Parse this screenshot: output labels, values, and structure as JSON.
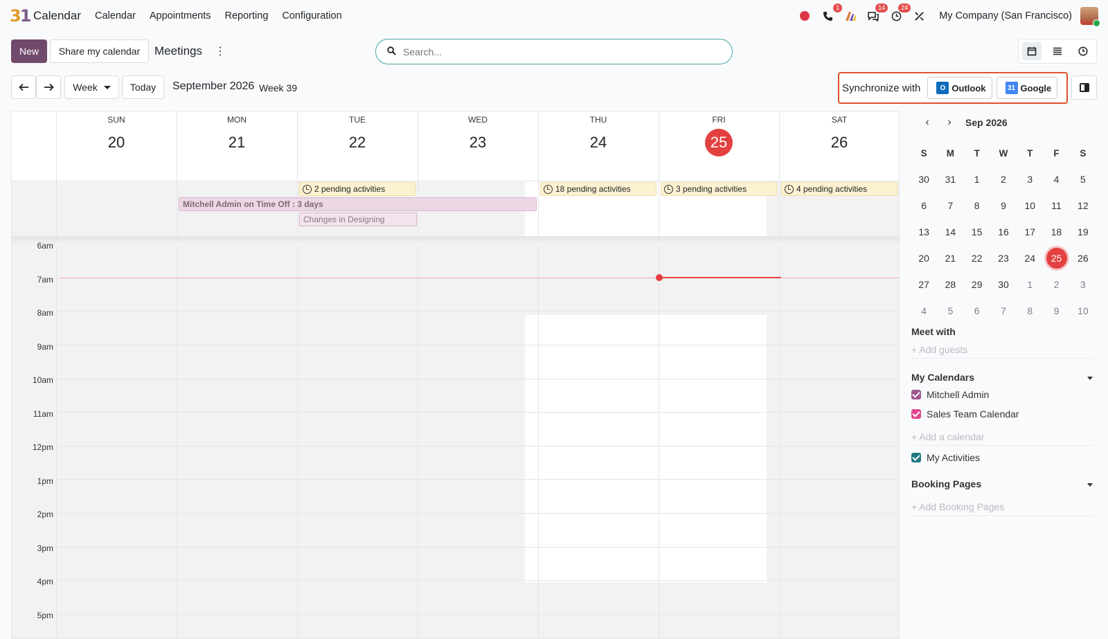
{
  "app": {
    "name": "Calendar"
  },
  "menu": [
    "Calendar",
    "Appointments",
    "Reporting",
    "Configuration"
  ],
  "systray": {
    "phone_badge": "1",
    "chat_badge": "14",
    "activity_badge": "24",
    "company": "My Company (San Francisco)"
  },
  "toolbar": {
    "new_label": "New",
    "share_label": "Share my calendar",
    "title": "Meetings",
    "search_placeholder": "Search...",
    "scale_label": "Week",
    "today_label": "Today",
    "date_label": "September 2026",
    "week_label": "Week 39",
    "sync_label": "Synchronize with",
    "outlook_label": "Outlook",
    "google_label": "Google"
  },
  "week": {
    "days": [
      {
        "name": "SUN",
        "num": "20"
      },
      {
        "name": "MON",
        "num": "21"
      },
      {
        "name": "TUE",
        "num": "22"
      },
      {
        "name": "WED",
        "num": "23"
      },
      {
        "name": "THU",
        "num": "24"
      },
      {
        "name": "FRI",
        "num": "25",
        "today": true
      },
      {
        "name": "SAT",
        "num": "26"
      }
    ],
    "hours": [
      "6am",
      "7am",
      "8am",
      "9am",
      "10am",
      "11am",
      "12pm",
      "1pm",
      "2pm",
      "3pm",
      "4pm",
      "5pm"
    ],
    "pending": {
      "tue": "2 pending activities",
      "thu": "18 pending activities",
      "fri": "3 pending activities",
      "sat": "4 pending activities"
    },
    "events": {
      "timeoff": "Mitchell Admin on Time Off : 3 days",
      "design": "Changes in Designing"
    }
  },
  "sidebar": {
    "month_label": "Sep 2026",
    "weekday_heads": [
      "S",
      "M",
      "T",
      "W",
      "T",
      "F",
      "S"
    ],
    "weeks": [
      [
        "30",
        "31",
        "1",
        "2",
        "3",
        "4",
        "5"
      ],
      [
        "6",
        "7",
        "8",
        "9",
        "10",
        "11",
        "12"
      ],
      [
        "13",
        "14",
        "15",
        "16",
        "17",
        "18",
        "19"
      ],
      [
        "20",
        "21",
        "22",
        "23",
        "24",
        "25",
        "26"
      ],
      [
        "27",
        "28",
        "29",
        "30",
        "1",
        "2",
        "3"
      ],
      [
        "4",
        "5",
        "6",
        "7",
        "8",
        "9",
        "10"
      ]
    ],
    "meet_with": "Meet with",
    "add_guests": "+ Add guests",
    "my_calendars": "My Calendars",
    "calendars": [
      {
        "label": "Mitchell Admin",
        "color": "#a0588f"
      },
      {
        "label": "Sales Team Calendar",
        "color": "#e0488f"
      }
    ],
    "add_calendar": "+ Add a calendar",
    "my_activities": "My Activities",
    "activities_color": "#1f7a80",
    "booking_pages": "Booking Pages",
    "add_booking": "+ Add Booking Pages"
  }
}
